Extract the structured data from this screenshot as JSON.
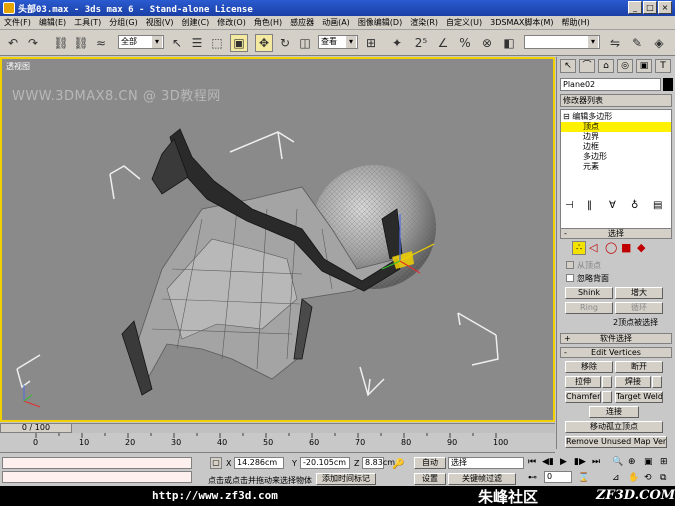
{
  "window": {
    "title": "头部03.max - 3ds max 6 - Stand-alone License",
    "buttons": [
      "_",
      "□",
      "×"
    ]
  },
  "menu": [
    "文件(F)",
    "编辑(E)",
    "工具(T)",
    "分组(G)",
    "视图(V)",
    "创建(C)",
    "修改(O)",
    "角色(H)",
    "感应器",
    "动画(A)",
    "图像编辑(D)",
    "渲染(R)",
    "自定义(U)",
    "3DSMAX脚本(M)",
    "帮助(H)"
  ],
  "toolbar": {
    "selection_filter": "全部",
    "coord_system": "查看"
  },
  "viewport": {
    "label": "透视图",
    "watermark": "WWW.3DMAX8.CN @ 3D教程网"
  },
  "panel": {
    "object_name": "Plane02",
    "modifier_list": "修改器列表",
    "stack": [
      {
        "label": "编辑多边形",
        "prefix": "⊟"
      },
      {
        "label": "顶点",
        "selected": true
      },
      {
        "label": "边界"
      },
      {
        "label": "边框"
      },
      {
        "label": "多边形"
      },
      {
        "label": "元素"
      }
    ],
    "selection": {
      "title": "选择",
      "by_vertex": "从顶点",
      "ignore_backface": "忽略背面",
      "shrink": "Shink",
      "grow": "增大",
      "ring": "Ring",
      "loop": "循环",
      "status": "2顶点被选择"
    },
    "soft_selection": "软件选择",
    "edit_vertices": {
      "title": "Edit Vertices",
      "remove": "移除",
      "break": "断开",
      "extrude": "拉伸",
      "weld": "焊接",
      "chamfer": "Chamfer",
      "target_weld": "Target Weld",
      "connect": "连接",
      "remove_isolated": "移动孤立顶点",
      "remove_unused_map": "Remove Unused Map Verts"
    }
  },
  "timeline": {
    "slider": "0 / 100",
    "ticks": [
      "0",
      "10",
      "20",
      "30",
      "40",
      "50",
      "60",
      "70",
      "80",
      "90",
      "100"
    ]
  },
  "status": {
    "x_label": "X",
    "x_value": "14.286cm",
    "y_label": "Y",
    "y_value": "-20.105cm",
    "z_label": "Z",
    "z_value": "8.83cm",
    "prompt": "点击或点击并拖动来选择物体",
    "add_time_tag": "添加时间标记",
    "auto_key": "自动",
    "set_key": "设置",
    "selection_set": "选择",
    "key_filters": "关键帧过滤",
    "frame": "0"
  },
  "footer": {
    "url": "http://www.zf3d.com",
    "logo": "朱峰社区",
    "site": "ZF3D.COM"
  }
}
